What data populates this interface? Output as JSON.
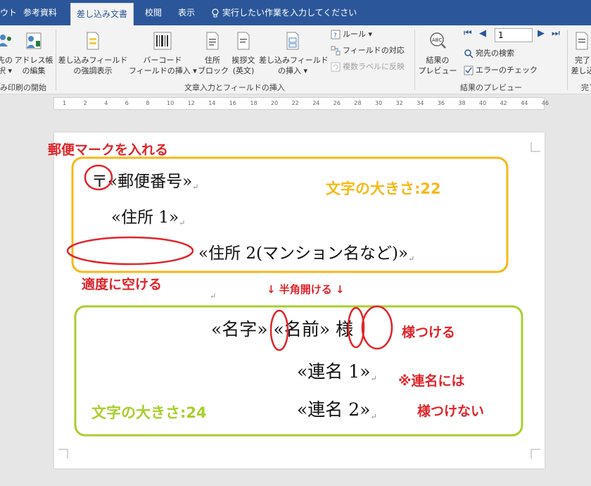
{
  "tabs": [
    {
      "label": "ウト"
    },
    {
      "label": "参考資料"
    },
    {
      "label": "差し込み文書"
    },
    {
      "label": "校閲"
    },
    {
      "label": "表示"
    }
  ],
  "tell_me": "実行したい作業を入力してください",
  "ribbon": {
    "start_group": {
      "btn1_line1": "先の",
      "btn1_line2": "択 ▾",
      "btn2_line1": "アドレス帳",
      "btn2_line2": "の編集",
      "label": "み印刷の開始"
    },
    "fields_group": {
      "highlight_line1": "差し込みフィールド",
      "highlight_line2": "の強調表示",
      "barcode_line1": "バーコード",
      "barcode_line2": "フィールドの挿入 ▾",
      "address_line1": "住所",
      "address_line2": "ブロック",
      "greeting_line1": "挨拶文",
      "greeting_line2": "(英文)",
      "insert_line1": "差し込みフィールド",
      "insert_line2": "の挿入 ▾",
      "rules": "ルール ▾",
      "match": "フィールドの対応",
      "update": "複数ラベルに反映",
      "label": "文章入力とフィールドの挿入"
    },
    "preview_group": {
      "preview_line1": "結果の",
      "preview_line2": "プレビュー",
      "record": "1",
      "find": "宛先の検索",
      "check": "エラーのチェック",
      "label": "結果のプレビュー"
    },
    "finish_group": {
      "line1": "完了",
      "line2": "差し込",
      "label": "完了"
    }
  },
  "ruler": [
    "1",
    "2",
    "4",
    "6",
    "8",
    "10",
    "12",
    "14",
    "16",
    "18",
    "20",
    "22",
    "24",
    "26",
    "28",
    "30",
    "32",
    "34",
    "36",
    "38",
    "40",
    "42",
    "44",
    "46"
  ],
  "document": {
    "postal_mark": "〒",
    "postal_field": "«郵便番号»",
    "address1": "«住所 1»",
    "address2": "«住所 2(マンション名など)»",
    "surname": "«名字»",
    "given": "«名前»",
    "honorific": "様",
    "joint1": "«連名 1»",
    "joint2": "«連名 2»"
  },
  "annotations": {
    "postal_note": "郵便マークを入れる",
    "size22": "文字の大きさ:22",
    "space_note": "適度に空ける",
    "half_space": "↓ 半角開ける ↓",
    "sama_note": "様つける",
    "joint_note1": "※連名には",
    "joint_note2": "様つけない",
    "size24": "文字の大きさ:24"
  },
  "colors": {
    "ribbon_tab_blue": "#2b579a",
    "red": "#e0242a",
    "yellow": "#f7b818",
    "green": "#a8cf2c"
  }
}
